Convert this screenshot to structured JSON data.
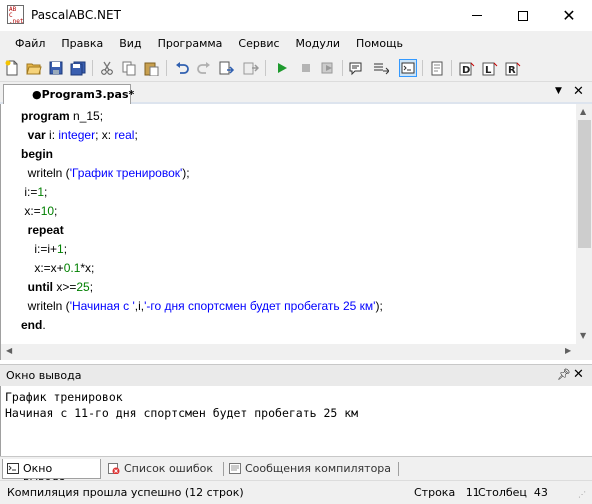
{
  "window": {
    "title": "PascalABC.NET",
    "minimize_glyph": "",
    "close_glyph": "✕"
  },
  "menu": [
    "Файл",
    "Правка",
    "Вид",
    "Программа",
    "Сервис",
    "Модули",
    "Помощь"
  ],
  "toolbar": {
    "icons": [
      "new-file-icon",
      "open-folder-icon",
      "save-icon",
      "save-all-icon",
      "cut-icon",
      "copy-icon",
      "paste-icon",
      "undo-icon",
      "redo-icon",
      "step-in-icon",
      "step-over-icon",
      "run-icon",
      "stop-icon",
      "watch-icon",
      "locals-icon",
      "output-window-icon",
      "form-designer-icon",
      "debug-icon",
      "load-icon",
      "refresh-icon"
    ]
  },
  "editor": {
    "tab_label": "●Program3.pas*",
    "code_lines": [
      [
        {
          "t": "program",
          "c": "kw"
        },
        {
          "t": " n_15;",
          "c": ""
        }
      ],
      [
        {
          "t": "  ",
          "c": ""
        },
        {
          "t": "var",
          "c": "kw"
        },
        {
          "t": " i: ",
          "c": ""
        },
        {
          "t": "integer",
          "c": "ty"
        },
        {
          "t": "; x: ",
          "c": ""
        },
        {
          "t": "real",
          "c": "ty"
        },
        {
          "t": ";",
          "c": ""
        }
      ],
      [
        {
          "t": "begin",
          "c": "kw"
        }
      ],
      [
        {
          "t": "  writeln (",
          "c": ""
        },
        {
          "t": "'График тренировок'",
          "c": "str"
        },
        {
          "t": ");",
          "c": ""
        }
      ],
      [
        {
          "t": " i:=",
          "c": ""
        },
        {
          "t": "1",
          "c": "num"
        },
        {
          "t": ";",
          "c": ""
        }
      ],
      [
        {
          "t": " x:=",
          "c": ""
        },
        {
          "t": "10",
          "c": "num"
        },
        {
          "t": ";",
          "c": ""
        }
      ],
      [
        {
          "t": "  ",
          "c": ""
        },
        {
          "t": "repeat",
          "c": "kw"
        }
      ],
      [
        {
          "t": "    i:=i+",
          "c": ""
        },
        {
          "t": "1",
          "c": "num"
        },
        {
          "t": ";",
          "c": ""
        }
      ],
      [
        {
          "t": "    x:=x+",
          "c": ""
        },
        {
          "t": "0.1",
          "c": "num"
        },
        {
          "t": "*x;",
          "c": ""
        }
      ],
      [
        {
          "t": "  ",
          "c": ""
        },
        {
          "t": "until",
          "c": "kw"
        },
        {
          "t": " x>=",
          "c": ""
        },
        {
          "t": "25",
          "c": "num"
        },
        {
          "t": ";",
          "c": ""
        }
      ],
      [
        {
          "t": "  writeln (",
          "c": ""
        },
        {
          "t": "'Начиная с '",
          "c": "str"
        },
        {
          "t": ",i,",
          "c": ""
        },
        {
          "t": "'-го дня спортсмен будет пробегать 25 км'",
          "c": "str"
        },
        {
          "t": ");",
          "c": ""
        }
      ],
      [
        {
          "t": "end",
          "c": "kw"
        },
        {
          "t": ".",
          "c": ""
        }
      ]
    ]
  },
  "output": {
    "title": "Окно вывода",
    "lines": [
      "График тренировок",
      "Начиная с 11-го дня спортсмен будет пробегать 25 км"
    ]
  },
  "bottom_tabs": [
    {
      "label": "Окно вывода",
      "icon": "output-window-icon",
      "active": true
    },
    {
      "label": "Список ошибок",
      "icon": "error-list-icon",
      "active": false
    },
    {
      "label": "Сообщения компилятора",
      "icon": "compiler-messages-icon",
      "active": false
    }
  ],
  "status": {
    "message": "Компиляция прошла успешно (12 строк)",
    "row_label": "Строка",
    "row_value": "11",
    "col_label": "Столбец",
    "col_value": "43"
  },
  "colors": {
    "keyword": "#000000",
    "type": "#0000ff",
    "number": "#008000",
    "string": "#0000ff",
    "active_tool": "#cce4f7"
  }
}
